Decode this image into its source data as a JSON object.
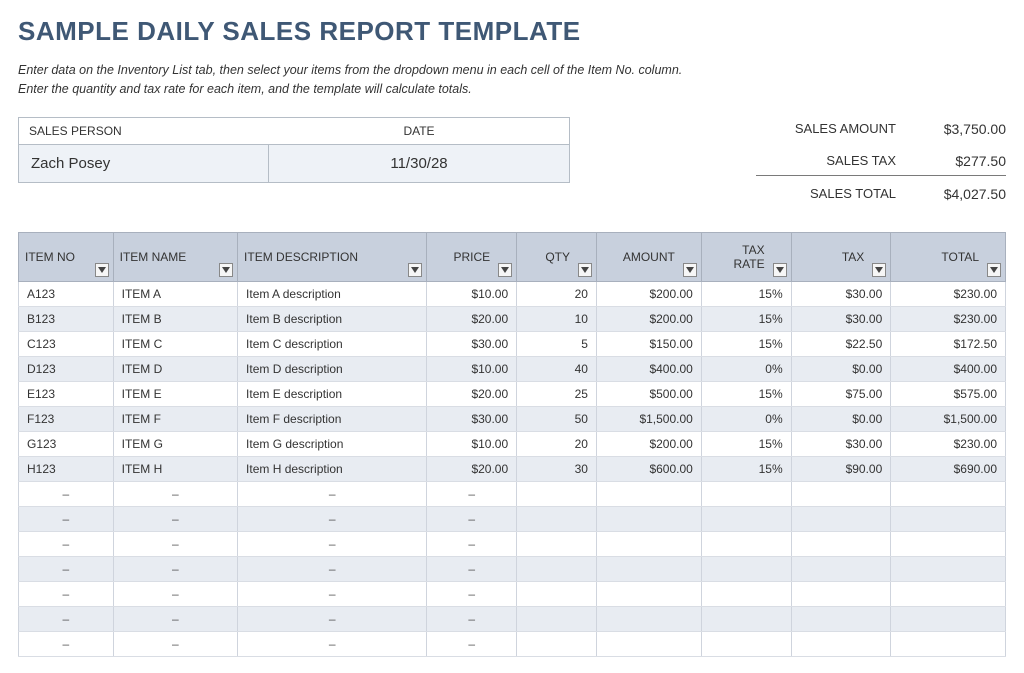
{
  "title": "SAMPLE DAILY SALES REPORT TEMPLATE",
  "instructions_line1": "Enter data on the Inventory List tab, then select your items from the dropdown menu in each cell of the Item No. column.",
  "instructions_line2": "Enter the quantity and tax rate for each item, and the template will calculate totals.",
  "header": {
    "sales_person_label": "SALES PERSON",
    "date_label": "DATE",
    "sales_person": "Zach Posey",
    "date": "11/30/28"
  },
  "summary": {
    "amount_label": "SALES AMOUNT",
    "amount_value": "$3,750.00",
    "tax_label": "SALES TAX",
    "tax_value": "$277.50",
    "total_label": "SALES TOTAL",
    "total_value": "$4,027.50"
  },
  "columns": {
    "item_no": "ITEM NO",
    "item_name": "ITEM NAME",
    "item_desc": "ITEM DESCRIPTION",
    "price": "PRICE",
    "qty": "QTY",
    "amount": "AMOUNT",
    "tax_rate": "TAX RATE",
    "tax": "TAX",
    "total": "TOTAL"
  },
  "rows": [
    {
      "itemno": "A123",
      "name": "ITEM A",
      "desc": "Item A description",
      "price": "$10.00",
      "qty": "20",
      "amount": "$200.00",
      "taxrate": "15%",
      "tax": "$30.00",
      "total": "$230.00"
    },
    {
      "itemno": "B123",
      "name": "ITEM B",
      "desc": "Item B description",
      "price": "$20.00",
      "qty": "10",
      "amount": "$200.00",
      "taxrate": "15%",
      "tax": "$30.00",
      "total": "$230.00"
    },
    {
      "itemno": "C123",
      "name": "ITEM C",
      "desc": "Item C description",
      "price": "$30.00",
      "qty": "5",
      "amount": "$150.00",
      "taxrate": "15%",
      "tax": "$22.50",
      "total": "$172.50"
    },
    {
      "itemno": "D123",
      "name": "ITEM D",
      "desc": "Item D description",
      "price": "$10.00",
      "qty": "40",
      "amount": "$400.00",
      "taxrate": "0%",
      "tax": "$0.00",
      "total": "$400.00"
    },
    {
      "itemno": "E123",
      "name": "ITEM E",
      "desc": "Item E description",
      "price": "$20.00",
      "qty": "25",
      "amount": "$500.00",
      "taxrate": "15%",
      "tax": "$75.00",
      "total": "$575.00"
    },
    {
      "itemno": "F123",
      "name": "ITEM F",
      "desc": "Item F description",
      "price": "$30.00",
      "qty": "50",
      "amount": "$1,500.00",
      "taxrate": "0%",
      "tax": "$0.00",
      "total": "$1,500.00"
    },
    {
      "itemno": "G123",
      "name": "ITEM G",
      "desc": "Item G description",
      "price": "$10.00",
      "qty": "20",
      "amount": "$200.00",
      "taxrate": "15%",
      "tax": "$30.00",
      "total": "$230.00"
    },
    {
      "itemno": "H123",
      "name": "ITEM H",
      "desc": "Item H description",
      "price": "$20.00",
      "qty": "30",
      "amount": "$600.00",
      "taxrate": "15%",
      "tax": "$90.00",
      "total": "$690.00"
    }
  ],
  "empty_dash": "–",
  "empty_row_count": 7
}
